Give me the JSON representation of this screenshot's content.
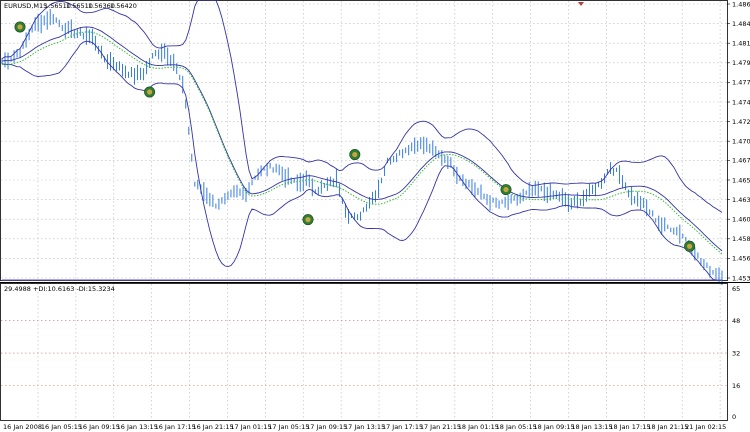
{
  "main_chart": {
    "title": "EURUSD,M15",
    "ohlc": [
      "1.56510",
      "1.56510",
      "1.56360",
      "1.56420"
    ],
    "price_ticks": [
      "1.48655",
      "1.48420",
      "1.48185",
      "1.47950",
      "1.47715",
      "1.47480",
      "1.47245",
      "1.47010",
      "1.46780",
      "1.46545",
      "1.46310",
      "1.46075",
      "1.45840",
      "1.45605",
      "1.45370"
    ],
    "ylim": [
      1.4537,
      1.48655
    ]
  },
  "indicator": {
    "label": "29.4988 +DI:10.6163 -DI:15.3234",
    "ticks": [
      "65",
      "48",
      "32",
      "16",
      "0"
    ],
    "ylim": [
      0,
      65
    ],
    "levels": [
      48,
      32,
      16
    ]
  },
  "time_axis": {
    "labels": [
      "16 Jan 2008",
      "16 Jan 05:15",
      "16 Jan 09:15",
      "16 Jan 13:15",
      "16 Jan 17:15",
      "16 Jan 21:15",
      "17 Jan 01:15",
      "17 Jan 05:15",
      "17 Jan 09:15",
      "17 Jan 13:15",
      "17 Jan 17:15",
      "17 Jan 21:15",
      "18 Jan 01:15",
      "18 Jan 05:15",
      "18 Jan 09:15",
      "18 Jan 13:15",
      "18 Jan 17:15",
      "18 Jan 21:15",
      "21 Jan 02:15"
    ]
  },
  "colors": {
    "bars": "#1e6de0",
    "bands": "#3434a8",
    "moving_average": "#33bb33",
    "adx": "#5a4dc4",
    "plus_di": "#000000",
    "minus_di": "#33a6c8"
  },
  "chart_data": {
    "type": "line",
    "series": [
      {
        "values": [
          1.4797,
          1.4801,
          1.4812,
          1.4838,
          1.4845,
          1.485,
          1.4838,
          1.4832,
          1.4829,
          1.4825,
          1.48,
          1.4795,
          1.4786,
          1.478,
          1.4783,
          1.4805,
          1.481,
          1.4795,
          1.476,
          1.465,
          1.464,
          1.4625,
          1.463,
          1.464,
          1.4638,
          1.466,
          1.4668,
          1.467,
          1.4658,
          1.465,
          1.4655,
          1.4642,
          1.4648,
          1.4655,
          1.4615,
          1.4607,
          1.4625,
          1.464,
          1.4676,
          1.4685,
          1.4692,
          1.4698,
          1.4695,
          1.4685,
          1.4678,
          1.466,
          1.465,
          1.464,
          1.463,
          1.4625,
          1.4628,
          1.4632,
          1.464,
          1.4643,
          1.4638,
          1.4635,
          1.4625,
          1.463,
          1.464,
          1.465,
          1.467,
          1.466,
          1.4635,
          1.4628,
          1.4615,
          1.46,
          1.4597,
          1.459,
          1.4575,
          1.4555,
          1.4545,
          1.454
        ]
      }
    ],
    "markers": [
      1.4838,
      1.476,
      1.4607,
      1.4685,
      1.4643,
      1.4575
    ]
  }
}
